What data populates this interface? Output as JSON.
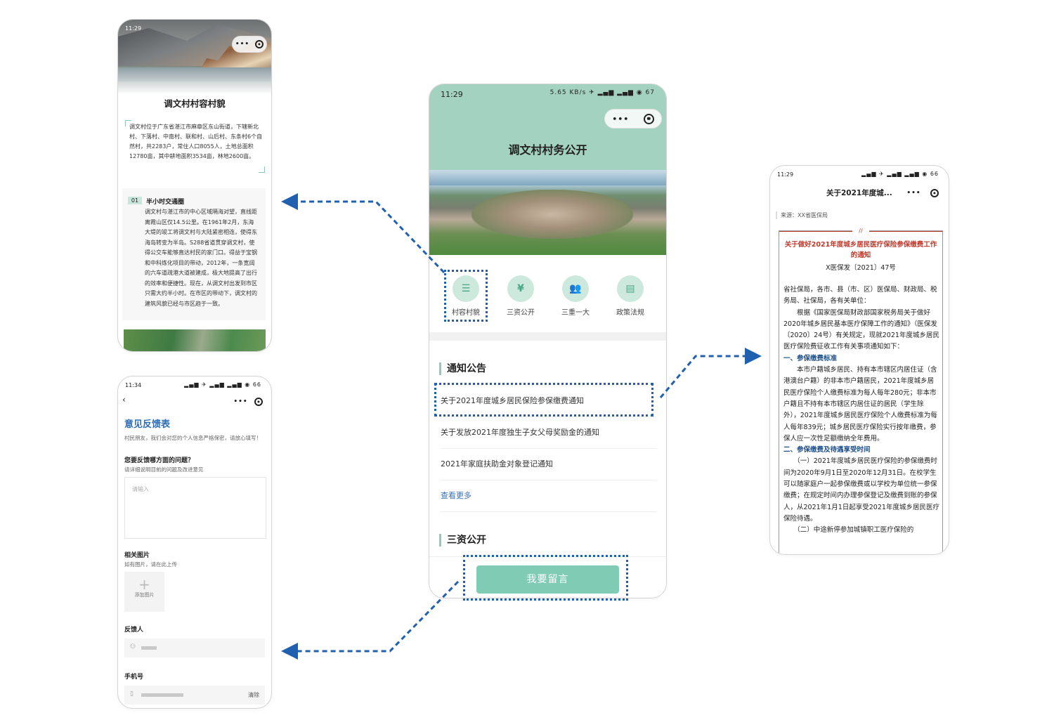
{
  "colors": {
    "accent": "#a4d2c1",
    "button": "#80cbb3",
    "link": "#3a6fb3",
    "doc_red": "#c0392b",
    "doc_blue": "#1d4f8a",
    "arrow": "#2060b0"
  },
  "main": {
    "time": "11:29",
    "status_icons": "5.65 KB/s ✈ ▂▄▆ ▂▄▆ ◉ 67",
    "title": "调文村村务公开",
    "categories": [
      {
        "label": "村容村貌",
        "icon": "layers-icon"
      },
      {
        "label": "三资公开",
        "icon": "money-icon"
      },
      {
        "label": "三重一大",
        "icon": "people-icon"
      },
      {
        "label": "政策法规",
        "icon": "book-icon"
      }
    ],
    "notice_heading": "通知公告",
    "notices": [
      "关于2021年度城乡居民保险参保缴费通知",
      "关于发放2021年度独生子女父母奖励金的通知",
      "2021年家庭扶助金对象登记通知"
    ],
    "more": "查看更多",
    "sanzi_heading": "三资公开",
    "message_button": "我要留言"
  },
  "village": {
    "time": "11:29",
    "title": "调文村村容村貌",
    "intro": "调文村位于广东省湛江市麻章区东山街道，下辖新北村、下落村、中南村、联和村、山后村、东条村6个自然村，共2283户，常住人口8055人，土地总面积12780亩，其中耕地面积3534亩，林地2600亩。",
    "section_num": "01",
    "section_title": "半小时交通圈",
    "section_text": "调文村与湛江市的中心区域隔海对望，直线距离霞山区仅14.5公里。在1961年2月，东海大堤的竣工将调文村与大陆紧密相连，使得东海岛转变为半岛。S288省道贯穿调文村，使得公交车能够直达村民的家门口。得益于宝钢和中科炼化项目的带动，2012年，一条宽阔的六车道疏港大道被建成，极大地提高了出行的效率和便捷性。现在，从调文村出发到市区只需大约半小时。在市区的带动下，调文村的建筑风貌已经与市区趋于一致。"
  },
  "notice_detail": {
    "time": "11:29",
    "status_icons": "▂▄▆ ✈ ▂▄▆ ▂▄▆ ◉ 66",
    "nav_title": "关于2021年度城...",
    "source": "来源：XX省医保局",
    "redmark": "//",
    "doc_title": "关于做好2021年度城乡居民医疗保险参保缴费工作的通知",
    "doc_no": "X医保发〔2021〕47号",
    "p1": "省社保局，各市、县（市、区）医保局、财政局、税务局、社保局，各有关单位：",
    "p2": "　　根据《国家医保局财政部国家税务局关于做好2020年城乡居民基本医疗保障工作的通知》（医保发〔2020〕24号）有关规定，现就2021年度城乡居民医疗保险费征收工作有关事项通知如下：",
    "h1": "一、参保缴费标准",
    "p3": "　　本市户籍城乡居民、持有本市辖区内居住证（含港澳台户籍）的非本市户籍居民，2021年度城乡居民医疗保险个人缴费标准为每人每年280元；非本市户籍且不持有本市辖区内居住证的居民（学生除外），2021年度城乡居民医疗保险个人缴费标准为每人每年839元；城乡居民医疗保险实行按年缴费，参保人应一次性足额缴纳全年费用。",
    "h2": "二、参保缴费及待遇享受时间",
    "p4": "　　（一）2021年度城乡居民医疗保险的参保缴费时间为2020年9月1日至2020年12月31日。在校学生可以随家庭户一起参保缴费或以学校为单位统一参保缴费；在规定时间内办理参保登记及缴费到账的参保人，从2021年1月1日起享受2021年度城乡居民医疗保险待遇。",
    "p5": "　　（二）中途新停参加城镇职工医疗保险的"
  },
  "feedback": {
    "time": "11:34",
    "status_icons": "▂▄▆ ✈ ▂▄▆ ▂▄▆ ◉ 66",
    "title": "意见反馈表",
    "subtitle": "村民朋友，我们会对您的个人信息严格保密，请放心填写！",
    "q_label": "您要反馈哪方面的问题？",
    "q_hint": "请详细说明目前的问题及改进意见",
    "q_placeholder": "请输入",
    "img_label": "相关图片",
    "img_hint": "如有图片，请在此上传",
    "add_image": "添加图片",
    "name_label": "反馈人",
    "phone_label": "手机号",
    "clear": "清除"
  }
}
